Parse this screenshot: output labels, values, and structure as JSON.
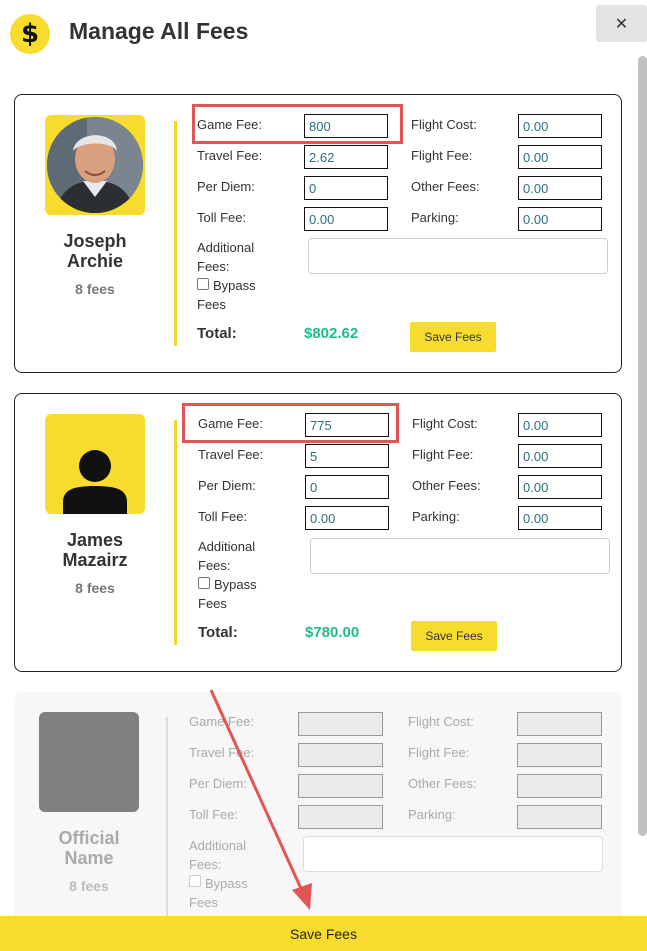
{
  "header": {
    "icon_glyph": "$",
    "title": "Manage All Fees",
    "close_glyph": "✕"
  },
  "labels": {
    "game_fee": "Game Fee:",
    "travel_fee": "Travel Fee:",
    "per_diem": "Per Diem:",
    "toll_fee": "Toll Fee:",
    "flight_cost": "Flight Cost:",
    "flight_fee": "Flight Fee:",
    "other_fees": "Other Fees:",
    "parking": "Parking:",
    "additional_line1": "Additional",
    "additional_line2": "Fees:",
    "bypass_line1": "Bypass",
    "bypass_line2": "Fees",
    "total": "Total:",
    "save_fees": "Save Fees"
  },
  "officials": [
    {
      "name_line1": "Joseph",
      "name_line2": "Archie",
      "fee_count": "8 fees",
      "game_fee": "800",
      "travel_fee": "2.62",
      "per_diem": "0",
      "toll_fee": "0.00",
      "flight_cost": "0.00",
      "flight_fee": "0.00",
      "other_fees": "0.00",
      "parking": "0.00",
      "total": "$802.62",
      "bypass_checked": false,
      "game_fee_highlighted": true
    },
    {
      "name_line1": "James",
      "name_line2": "Mazairz",
      "fee_count": "8 fees",
      "game_fee": "775",
      "travel_fee": "5",
      "per_diem": "0",
      "toll_fee": "0.00",
      "flight_cost": "0.00",
      "flight_fee": "0.00",
      "other_fees": "0.00",
      "parking": "0.00",
      "total": "$780.00",
      "bypass_checked": false,
      "game_fee_highlighted": true
    },
    {
      "name_line1": "Official",
      "name_line2": "Name",
      "fee_count": "8 fees",
      "disabled": true
    }
  ],
  "footer": {
    "save_fees": "Save Fees"
  },
  "colors": {
    "accent": "#f7dc2e",
    "total": "#1dbd8c",
    "annotation": "#e35454",
    "input_text": "#2c6f80"
  }
}
